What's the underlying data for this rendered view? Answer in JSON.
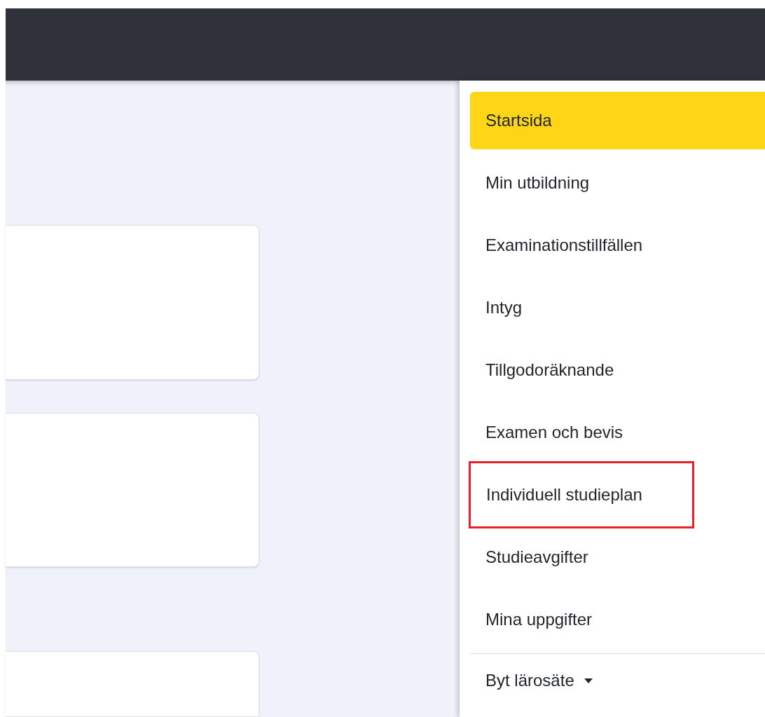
{
  "menu": {
    "items": [
      {
        "label": "Startsida",
        "selected": true,
        "highlighted": false
      },
      {
        "label": "Min utbildning",
        "selected": false,
        "highlighted": false
      },
      {
        "label": "Examinationstillfällen",
        "selected": false,
        "highlighted": false
      },
      {
        "label": "Intyg",
        "selected": false,
        "highlighted": false
      },
      {
        "label": "Tillgodoräknande",
        "selected": false,
        "highlighted": false
      },
      {
        "label": "Examen och bevis",
        "selected": false,
        "highlighted": false
      },
      {
        "label": "Individuell studieplan",
        "selected": false,
        "highlighted": true
      },
      {
        "label": "Studieavgifter",
        "selected": false,
        "highlighted": false
      },
      {
        "label": "Mina uppgifter",
        "selected": false,
        "highlighted": false
      }
    ],
    "footer": {
      "label": "Byt lärosäte",
      "expanded": false
    }
  }
}
